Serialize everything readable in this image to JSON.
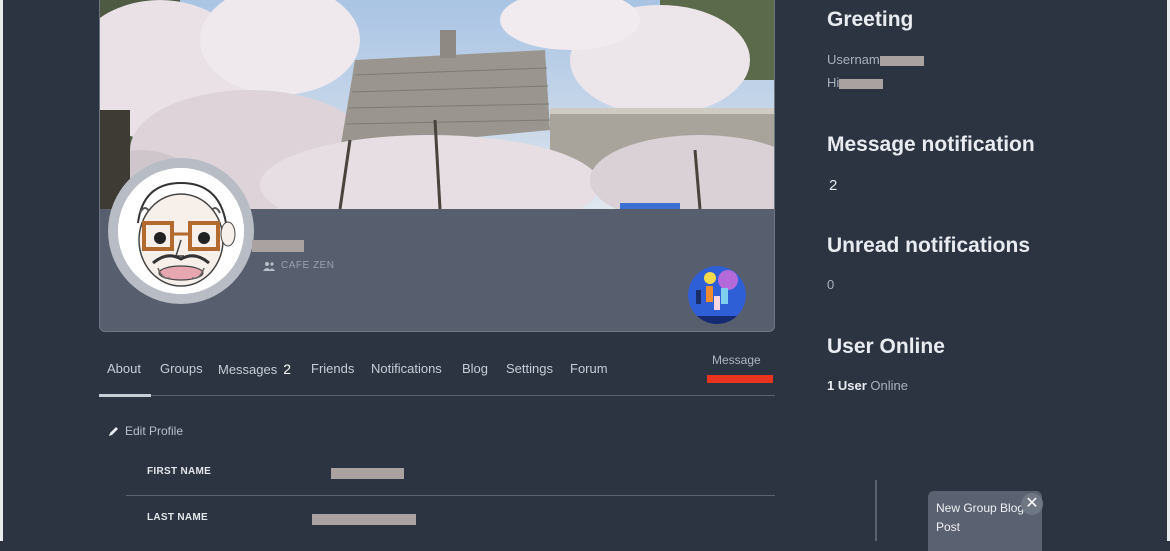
{
  "profile": {
    "group_name": "CAFE ZEN"
  },
  "tabs": [
    {
      "label": "About"
    },
    {
      "label": "Groups"
    },
    {
      "label": "Messages",
      "count": "2"
    },
    {
      "label": "Friends"
    },
    {
      "label": "Notifications"
    },
    {
      "label": "Blog"
    },
    {
      "label": "Settings"
    },
    {
      "label": "Forum"
    }
  ],
  "message_button": "Message",
  "edit_profile": "Edit Profile",
  "fields": [
    {
      "label": "FIRST NAME"
    },
    {
      "label": "LAST NAME"
    }
  ],
  "sidebar": {
    "greeting_title": "Greeting",
    "username_prefix": "Usernam",
    "hi_prefix": "Hi",
    "message_notification_title": "Message notification",
    "message_notification_count": "2",
    "unread_title": "Unread notifications",
    "unread_count": "0",
    "online_title": "User Online",
    "online_count": "1 User",
    "online_suffix": "Online"
  },
  "toast": {
    "text": "New Group Blog Post",
    "close": "✕"
  },
  "colors": {
    "background": "#2c3442",
    "card": "#575e6d",
    "accent_red": "#e8331f",
    "redaction": "#a9a2a1"
  }
}
